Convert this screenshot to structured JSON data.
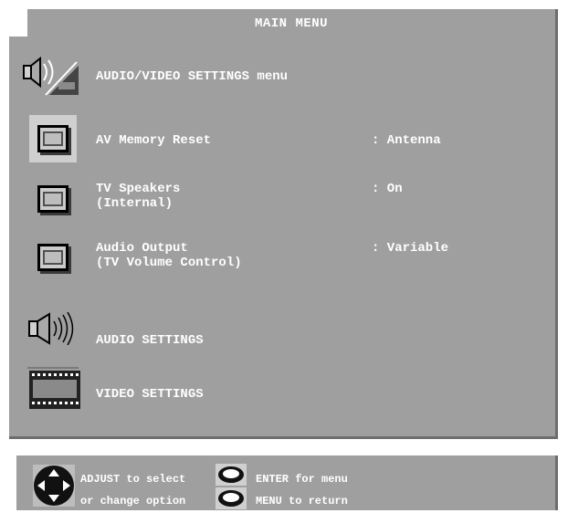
{
  "window": {
    "title": "MAIN MENU"
  },
  "header": {
    "label": "AUDIO/VIDEO SETTINGS menu",
    "icon": "speaker-film-icon"
  },
  "settings": [
    {
      "name": "av-memory-reset",
      "label": "AV Memory Reset",
      "value": ": Antenna",
      "selected": true
    },
    {
      "name": "tv-speakers",
      "label": "TV Speakers\n(Internal)",
      "value": ": On",
      "selected": false
    },
    {
      "name": "audio-output",
      "label": "Audio Output\n(TV Volume Control)",
      "value": ": Variable",
      "selected": false
    }
  ],
  "submenus": [
    {
      "name": "audio-settings",
      "label": "AUDIO SETTINGS",
      "icon": "speaker-icon"
    },
    {
      "name": "video-settings",
      "label": "VIDEO SETTINGS",
      "icon": "film-strip-icon"
    }
  ],
  "footer": {
    "adjust_line1": "ADJUST to select",
    "adjust_line2": "or change option",
    "enter_label": "ENTER for menu",
    "menu_label": "MENU to return",
    "dpad_icon": "dpad-icon",
    "enter_icon": "enter-button-icon",
    "menu_icon": "menu-button-icon"
  },
  "colors": {
    "panel": "#9f9f9f",
    "shadow": "#6d6d6d",
    "text": "#ffffff"
  }
}
